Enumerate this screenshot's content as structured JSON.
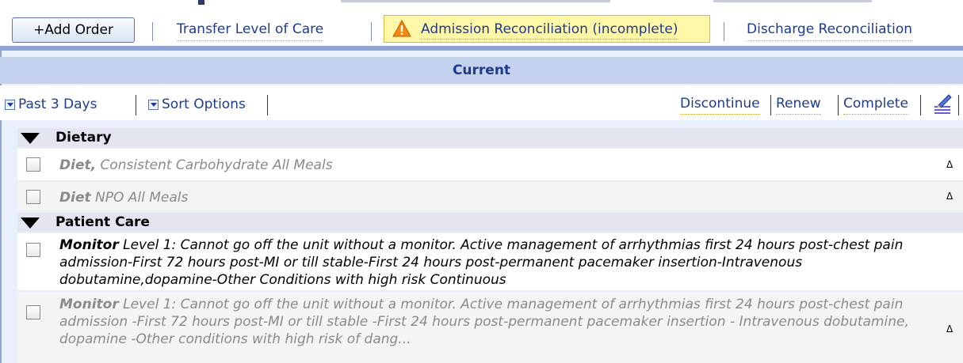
{
  "toolbar": {
    "add_order": "+Add Order",
    "transfer": "Transfer Level of Care",
    "admission": "Admission Reconciliation (incomplete)",
    "discharge": "Discharge Reconciliation"
  },
  "panel": {
    "header": "Current",
    "filters": [
      "Past 3 Days",
      "Sort Options"
    ],
    "actions": [
      "Discontinue",
      "Renew",
      "Complete"
    ]
  },
  "groups": [
    {
      "label": "Dietary",
      "orders": [
        {
          "name": "Diet,",
          "detail": " Consistent Carbohydrate All Meals"
        },
        {
          "name": "Diet",
          "detail": " NPO All Meals"
        }
      ]
    },
    {
      "label": "Patient Care",
      "orders": [
        {
          "name": "Monitor",
          "detail": " Level 1: Cannot go off the unit without a monitor. Active management of arrhythmias first 24 hours post-chest pain admission-First 72 hours post-MI or till stable-First 24 hours post-permanent pacemaker insertion-Intravenous dobutamine,dopamine-Other Conditions with high risk Continuous"
        },
        {
          "name": "Monitor",
          "detail": " Level 1: Cannot go off the unit without a monitor. Active management of arrhythmias first 24 hours post-chest pain admission -First 72 hours post-MI or till stable -First 24 hours post-permanent pacemaker insertion - Intravenous dobutamine, dopamine -Other conditions with high risk of dang..."
        }
      ]
    }
  ],
  "row_marker": "Δ",
  "icons": {
    "warning": "warning-icon",
    "edit": "edit-pen-icon"
  },
  "colors": {
    "accent": "#1f3b8e",
    "panel": "#c5d2ee",
    "warning_bg": "#fff7a8"
  }
}
